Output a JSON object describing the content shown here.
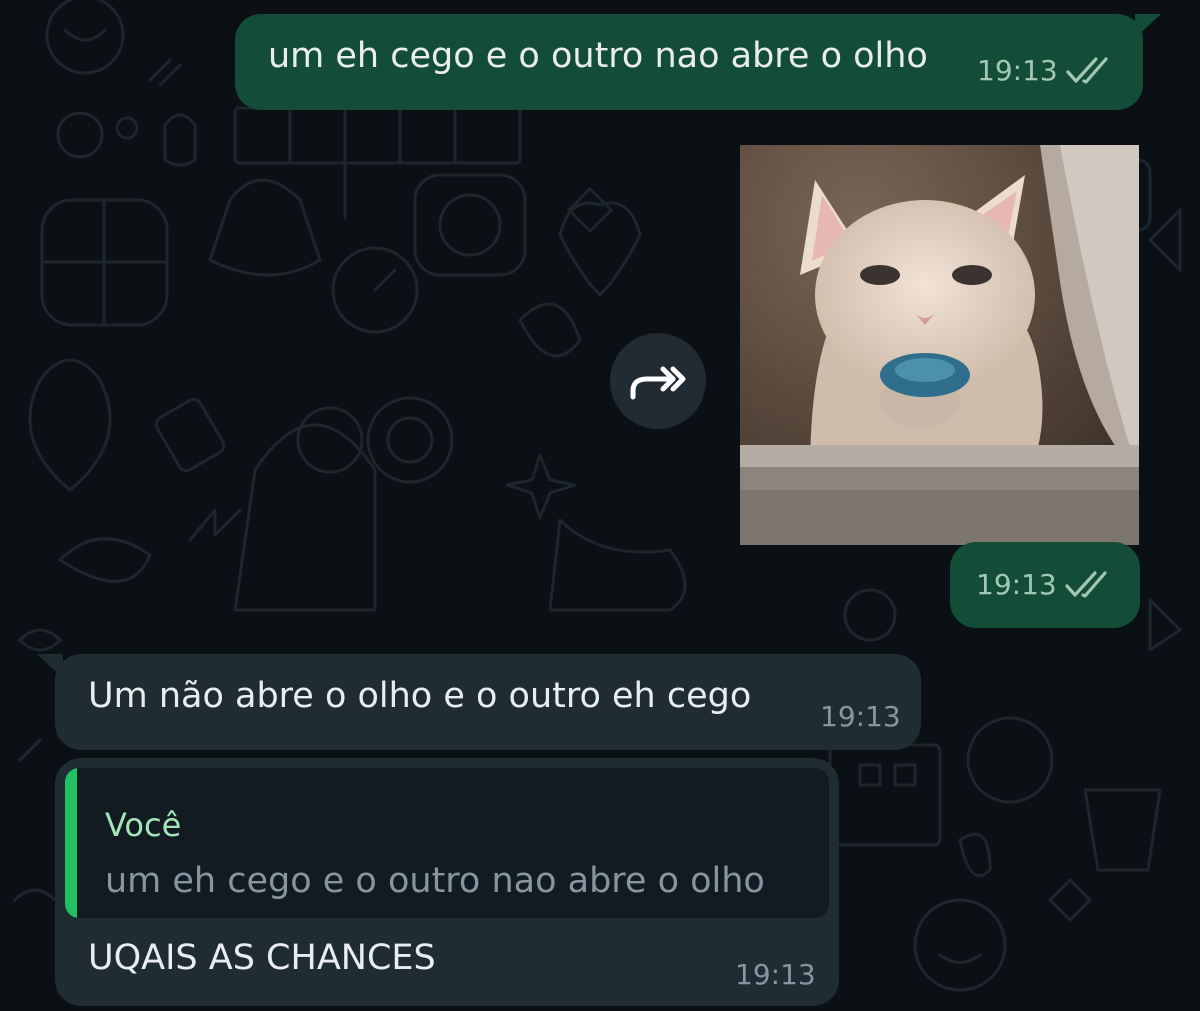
{
  "colors": {
    "background": "#0b1014",
    "outgoing_bubble": "#144d37",
    "incoming_bubble": "#1f2c34",
    "quote_accent": "#21c063",
    "read_ticks": "#a3c7b6"
  },
  "messages": [
    {
      "direction": "outgoing",
      "type": "text",
      "text": "um eh cego e o outro nao abre o olho",
      "time": "19:13",
      "status_icon": "double-check-read-icon"
    },
    {
      "direction": "outgoing",
      "type": "image",
      "image_description_icon": "cat-photo",
      "time": "19:13",
      "status_icon": "double-check-read-icon",
      "forward_icon": "forward-icon"
    },
    {
      "direction": "incoming",
      "type": "text",
      "text": "Um não abre o olho e o outro eh cego",
      "time": "19:13"
    },
    {
      "direction": "incoming",
      "type": "reply",
      "quoted": {
        "author": "Você",
        "text": "um eh cego e o outro nao abre o olho"
      },
      "text": "UQAIS AS CHANCES",
      "time": "19:13"
    }
  ]
}
